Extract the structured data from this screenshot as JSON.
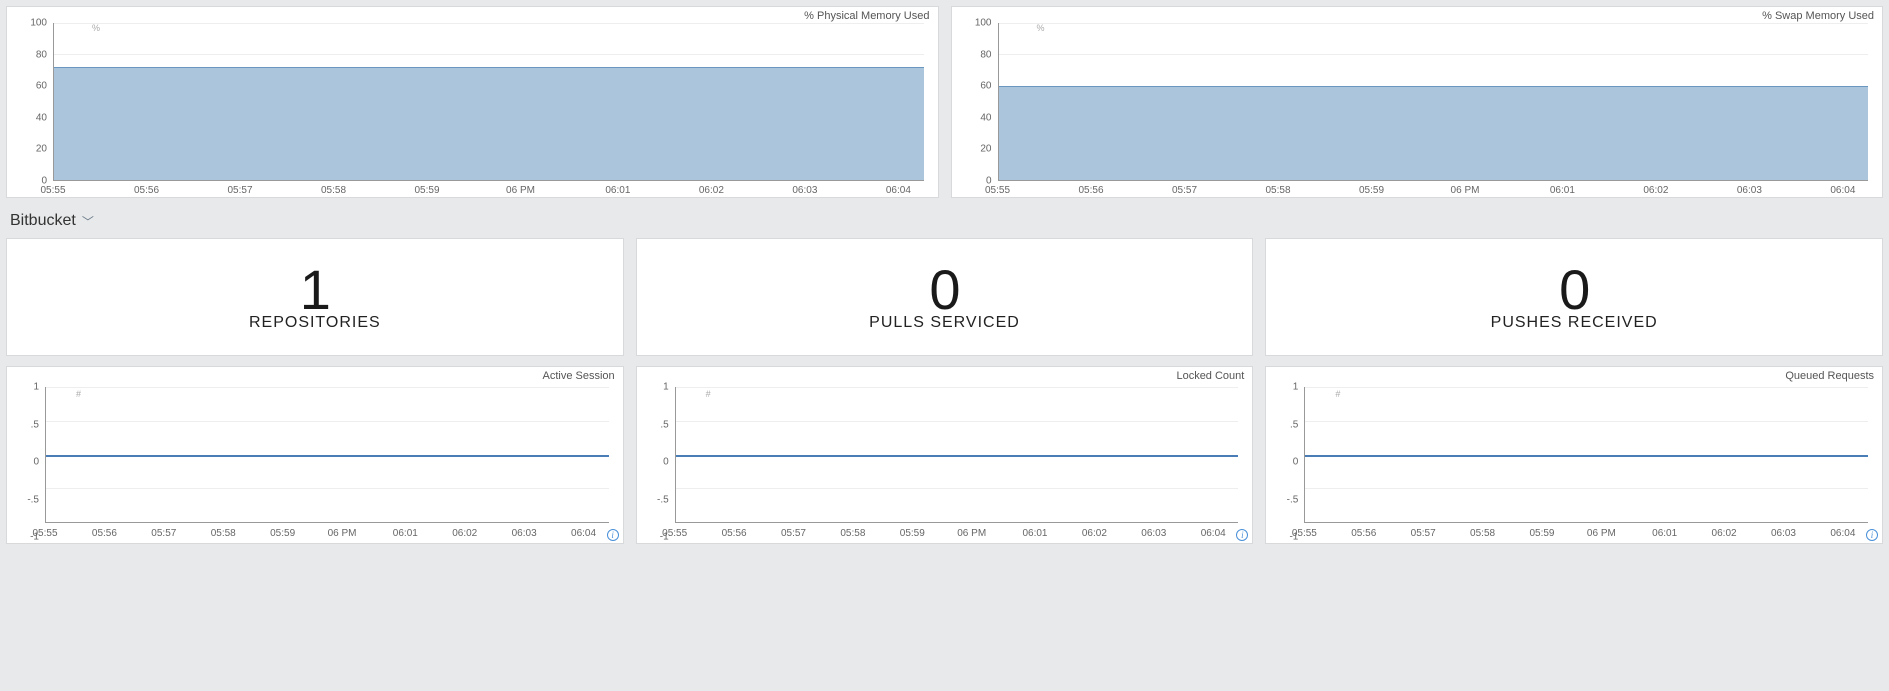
{
  "chart_data": [
    {
      "type": "area",
      "title": "% Physical Memory Used",
      "ylabel": "%",
      "ylim": [
        0,
        100
      ],
      "y_ticks": [
        0,
        20,
        40,
        60,
        80,
        100
      ],
      "x_ticks": [
        "05:55",
        "05:56",
        "05:57",
        "05:58",
        "05:59",
        "06 PM",
        "06:01",
        "06:02",
        "06:03",
        "06:04"
      ],
      "series": [
        {
          "name": "% Physical Memory Used",
          "values": [
            72,
            72,
            72,
            72,
            72,
            72,
            72,
            72,
            72,
            72
          ]
        }
      ]
    },
    {
      "type": "area",
      "title": "% Swap Memory Used",
      "ylabel": "%",
      "ylim": [
        0,
        100
      ],
      "y_ticks": [
        0,
        20,
        40,
        60,
        80,
        100
      ],
      "x_ticks": [
        "05:55",
        "05:56",
        "05:57",
        "05:58",
        "05:59",
        "06 PM",
        "06:01",
        "06:02",
        "06:03",
        "06:04"
      ],
      "series": [
        {
          "name": "% Swap Memory Used",
          "values": [
            60,
            60,
            60,
            60,
            60,
            60,
            60,
            60,
            60,
            60
          ]
        }
      ]
    },
    {
      "type": "line",
      "title": "Active Session",
      "ylim": [
        -1,
        1
      ],
      "y_ticks": [
        -1,
        -0.5,
        0,
        0.5,
        1
      ],
      "x_ticks": [
        "05:55",
        "05:56",
        "05:57",
        "05:58",
        "05:59",
        "06 PM",
        "06:01",
        "06:02",
        "06:03",
        "06:04"
      ],
      "series": [
        {
          "name": "Active Session",
          "values": [
            0,
            0,
            0,
            0,
            0,
            0,
            0,
            0,
            0,
            0
          ]
        }
      ]
    },
    {
      "type": "line",
      "title": "Locked Count",
      "ylim": [
        -1,
        1
      ],
      "y_ticks": [
        -1,
        -0.5,
        0,
        0.5,
        1
      ],
      "x_ticks": [
        "05:55",
        "05:56",
        "05:57",
        "05:58",
        "05:59",
        "06 PM",
        "06:01",
        "06:02",
        "06:03",
        "06:04"
      ],
      "series": [
        {
          "name": "Locked Count",
          "values": [
            0,
            0,
            0,
            0,
            0,
            0,
            0,
            0,
            0,
            0
          ]
        }
      ]
    },
    {
      "type": "line",
      "title": "Queued Requests",
      "ylim": [
        -1,
        1
      ],
      "y_ticks": [
        -1,
        -0.5,
        0,
        0.5,
        1
      ],
      "x_ticks": [
        "05:55",
        "05:56",
        "05:57",
        "05:58",
        "05:59",
        "06 PM",
        "06:01",
        "06:02",
        "06:03",
        "06:04"
      ],
      "series": [
        {
          "name": "Queued Requests",
          "values": [
            0,
            0,
            0,
            0,
            0,
            0,
            0,
            0,
            0,
            0
          ]
        }
      ]
    }
  ],
  "mem_charts": {
    "physical": {
      "title": "% Physical Memory Used",
      "fill_pct": 72
    },
    "swap": {
      "title": "% Swap Memory Used",
      "fill_pct": 60
    },
    "y_ticks": [
      "0",
      "20",
      "40",
      "60",
      "80",
      "100"
    ],
    "x_ticks": [
      "05:55",
      "05:56",
      "05:57",
      "05:58",
      "05:59",
      "06 PM",
      "06:01",
      "06:02",
      "06:03",
      "06:04"
    ],
    "unit": "%"
  },
  "section": {
    "name": "Bitbucket"
  },
  "stats": {
    "repositories": {
      "value": "1",
      "label": "REPOSITORIES"
    },
    "pulls": {
      "value": "0",
      "label": "PULLS SERVICED"
    },
    "pushes": {
      "value": "0",
      "label": "PUSHES RECEIVED"
    }
  },
  "mini_charts": {
    "active_session": {
      "title": "Active Session"
    },
    "locked_count": {
      "title": "Locked Count"
    },
    "queued_requests": {
      "title": "Queued Requests"
    },
    "y_ticks": [
      "-1",
      "-.5",
      "0",
      ".5",
      "1"
    ],
    "x_ticks": [
      "05:55",
      "05:56",
      "05:57",
      "05:58",
      "05:59",
      "06 PM",
      "06:01",
      "06:02",
      "06:03",
      "06:04"
    ]
  }
}
